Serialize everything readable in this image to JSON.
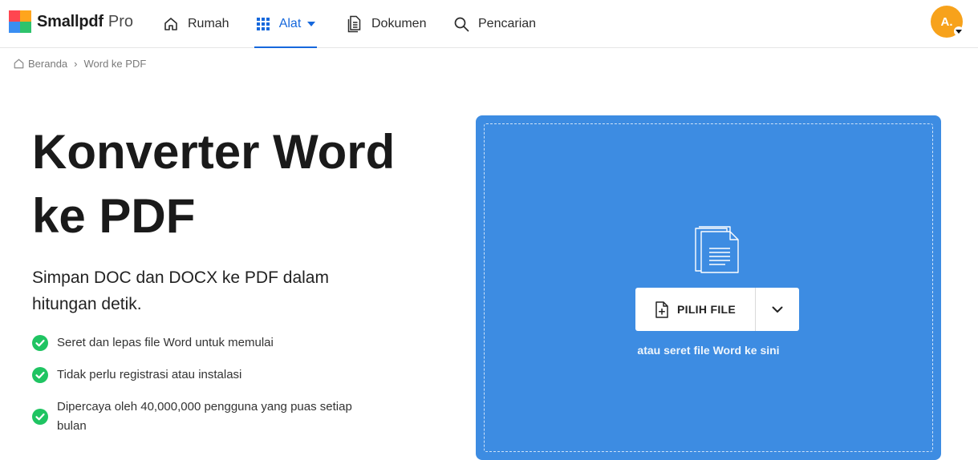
{
  "header": {
    "brand": "Smallpdf",
    "plan": "Pro",
    "nav": [
      {
        "label": "Rumah",
        "icon": "home-icon"
      },
      {
        "label": "Alat",
        "icon": "grid-icon",
        "active": true
      },
      {
        "label": "Dokumen",
        "icon": "documents-icon"
      },
      {
        "label": "Pencarian",
        "icon": "search-icon"
      }
    ],
    "avatar_initials": "A."
  },
  "breadcrumb": {
    "home": "Beranda",
    "separator": "›",
    "current": "Word ke PDF"
  },
  "hero": {
    "title_line1": "Konverter Word",
    "title_line2": "ke PDF",
    "subtitle": "Simpan DOC dan DOCX ke PDF dalam hitungan detik.",
    "features": [
      "Seret dan lepas file Word untuk memulai",
      "Tidak perlu registrasi atau instalasi",
      "Dipercaya oleh 40,000,000 pengguna yang puas setiap bulan"
    ]
  },
  "uploader": {
    "choose_label": "PILIH FILE",
    "drop_hint": "atau seret file Word ke sini"
  },
  "colors": {
    "accent": "#1668dc",
    "dropzone": "#3d8ce2",
    "check": "#1fc462",
    "avatar": "#f7a21b"
  }
}
